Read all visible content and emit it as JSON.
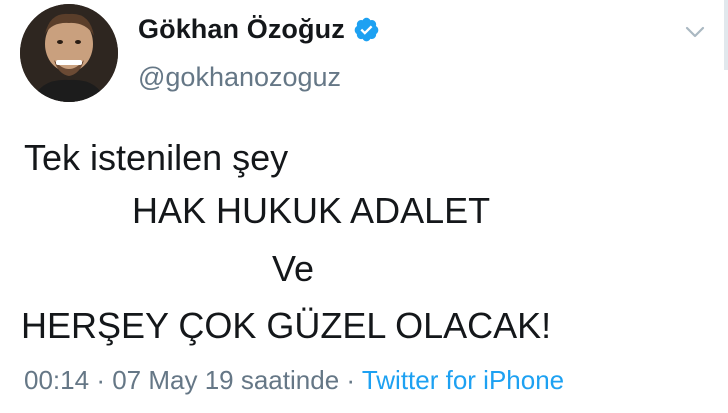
{
  "tweet": {
    "display_name": "Gökhan Özoğuz",
    "handle": "@gokhanozoguz",
    "verified": true,
    "lines": [
      "Tek istenilen şey",
      "HAK HUKUK ADALET",
      "Ve",
      "HERŞEY ÇOK GÜZEL OLACAK!"
    ],
    "time": "00:14",
    "separator": "·",
    "date": "07 May 19 saatinde",
    "source": "Twitter for iPhone"
  },
  "colors": {
    "text": "#14171a",
    "secondary": "#657786",
    "accent": "#1da1f2"
  },
  "icons": {
    "verified": "verified-badge-icon",
    "menu": "chevron-down-icon"
  }
}
